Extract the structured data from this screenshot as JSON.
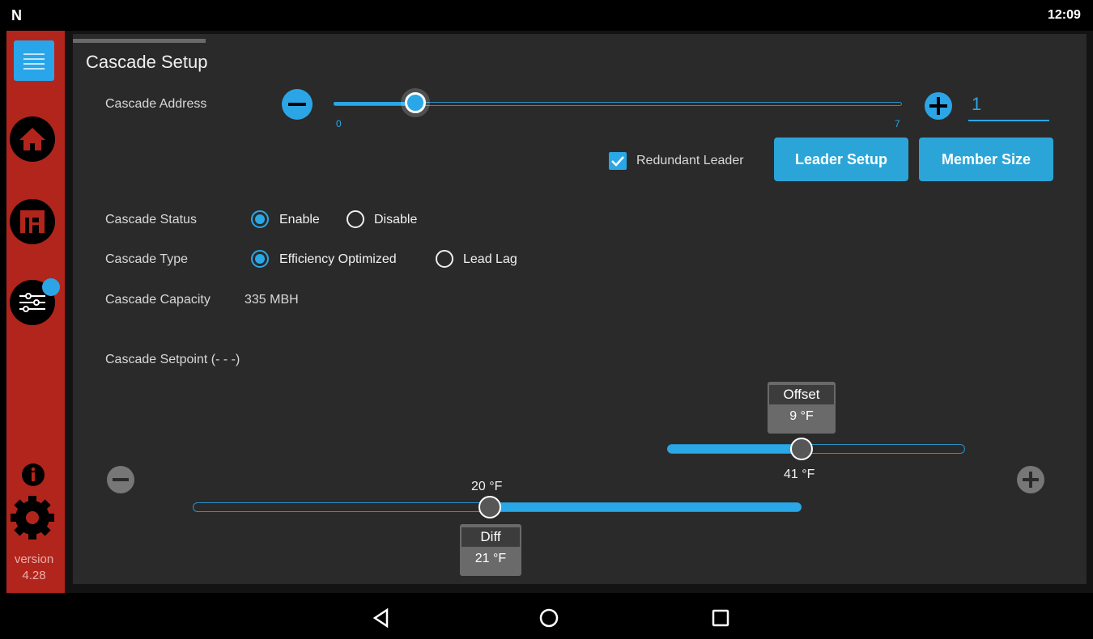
{
  "status_bar": {
    "logo": "N",
    "time": "12:09"
  },
  "sidebar": {
    "items": [
      "menu-icon",
      "home-icon",
      "dashboard-icon",
      "settings-sliders-icon",
      "info-icon",
      "gear-icon"
    ],
    "version_label": "version",
    "version_number": "4.28"
  },
  "header": {
    "title": "Cascade Setup"
  },
  "address": {
    "label": "Cascade Address",
    "min_label": "0",
    "max_label": "7",
    "value": "1",
    "slider_min": 0,
    "slider_max": 7
  },
  "actions": {
    "redundant_leader_label": "Redundant Leader",
    "redundant_leader_checked": true,
    "leader_setup": "Leader Setup",
    "member_size": "Member Size"
  },
  "status": {
    "label": "Cascade Status",
    "option_enable": "Enable",
    "option_disable": "Disable",
    "selected": "Enable"
  },
  "type": {
    "label": "Cascade Type",
    "option_efficiency": "Efficiency Optimized",
    "option_leadlag": "Lead Lag",
    "selected": "Efficiency Optimized"
  },
  "capacity": {
    "label": "Cascade Capacity",
    "value": "335 MBH"
  },
  "setpoint": {
    "label": "Cascade Setpoint (- - -)",
    "offset_label": "Offset",
    "offset_value": "9 °F",
    "offset_thumb_value": "41 °F",
    "diff_label": "Diff",
    "diff_value": "21 °F",
    "diff_thumb_value": "20 °F"
  },
  "colors": {
    "accent": "#2ba5d8",
    "sidebar": "#b2251c",
    "panel": "#2a2a2a"
  }
}
